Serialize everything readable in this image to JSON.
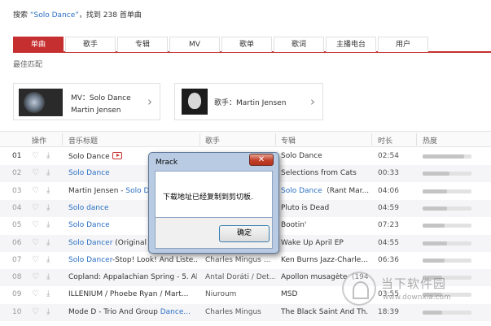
{
  "header": {
    "prefix": "搜索 ",
    "keyword": "“Solo Dance”",
    "suffix": "，找到 238 首单曲"
  },
  "tabs": [
    {
      "label": "单曲"
    },
    {
      "label": "歌手"
    },
    {
      "label": "专辑"
    },
    {
      "label": "MV"
    },
    {
      "label": "歌单"
    },
    {
      "label": "歌词"
    },
    {
      "label": "主播电台"
    },
    {
      "label": "用户"
    }
  ],
  "best_match": {
    "label": "最佳匹配",
    "mv_card": {
      "line1": "MV：Solo Dance",
      "line2": "Martin Jensen"
    },
    "artist_card": {
      "text": "歌手：Martin Jensen"
    }
  },
  "table": {
    "headers": {
      "ops": "操作",
      "title": "音乐标题",
      "artist": "歌手",
      "album": "专辑",
      "duration": "时长",
      "popularity": "热度"
    },
    "rows": [
      {
        "num": "01",
        "title": "Solo Dance",
        "artist": "",
        "album": "Solo Dance",
        "duration": "02:54",
        "pop": 0.85
      },
      {
        "num": "02",
        "title": "Solo Dance",
        "artist": "",
        "album": "Selections from Cats",
        "duration": "00:33",
        "pop": 0.55
      },
      {
        "num": "03",
        "title_pre": "Martin Jensen - ",
        "title": "Solo Da",
        "artist": "",
        "album_pre": "Solo Dance",
        "album": "（Rant Mar...",
        "duration": "04:06",
        "pop": 0.5
      },
      {
        "num": "04",
        "title": "Solo dance",
        "artist": "",
        "album": "Pluto is Dead",
        "duration": "04:59",
        "pop": 0.5
      },
      {
        "num": "05",
        "title": "Solo Dance",
        "artist": "",
        "album": "Bootin'",
        "duration": "07:23",
        "pop": 0.45
      },
      {
        "num": "06",
        "title": "Solo Dancer",
        "title_post": " (Original M",
        "artist": "",
        "album": "Wake Up April EP",
        "duration": "04:55",
        "pop": 0.5
      },
      {
        "num": "07",
        "title": "Solo Dancer",
        "title_post": "-Stop! Look! And Liste...",
        "artist": "Charles Mingus ...",
        "album": "Ken Burns Jazz-Charle...",
        "duration": "06:36",
        "pop": 0.45
      },
      {
        "num": "08",
        "title": "Copland: Appalachian Spring - 5. Al...",
        "artist": "Antal Doráti / Det...",
        "album": "Apollon musagète（194...",
        "duration": "",
        "pop": 0.4
      },
      {
        "num": "09",
        "title": "ILLENIUM / Phoebe Ryan / Mart...",
        "artist": "Niuroum",
        "album": "MSD",
        "duration": "03:55",
        "pop": 0.4
      },
      {
        "num": "10",
        "title_pre": "Mode D - Trio And Group ",
        "title": "Dance...",
        "artist": "Charles Mingus",
        "album": "The Black Saint And Th...",
        "duration": "18:39",
        "pop": 0.4
      }
    ]
  },
  "dialog": {
    "title": "Mrack",
    "close": "✕",
    "message": "下载地址已经复制到剪切板.",
    "ok": "确定"
  },
  "watermark": {
    "title": "当下软件园",
    "url": "www.downxia.com"
  },
  "colors": {
    "accent": "#c62f2f",
    "link": "#2b6fc2"
  }
}
